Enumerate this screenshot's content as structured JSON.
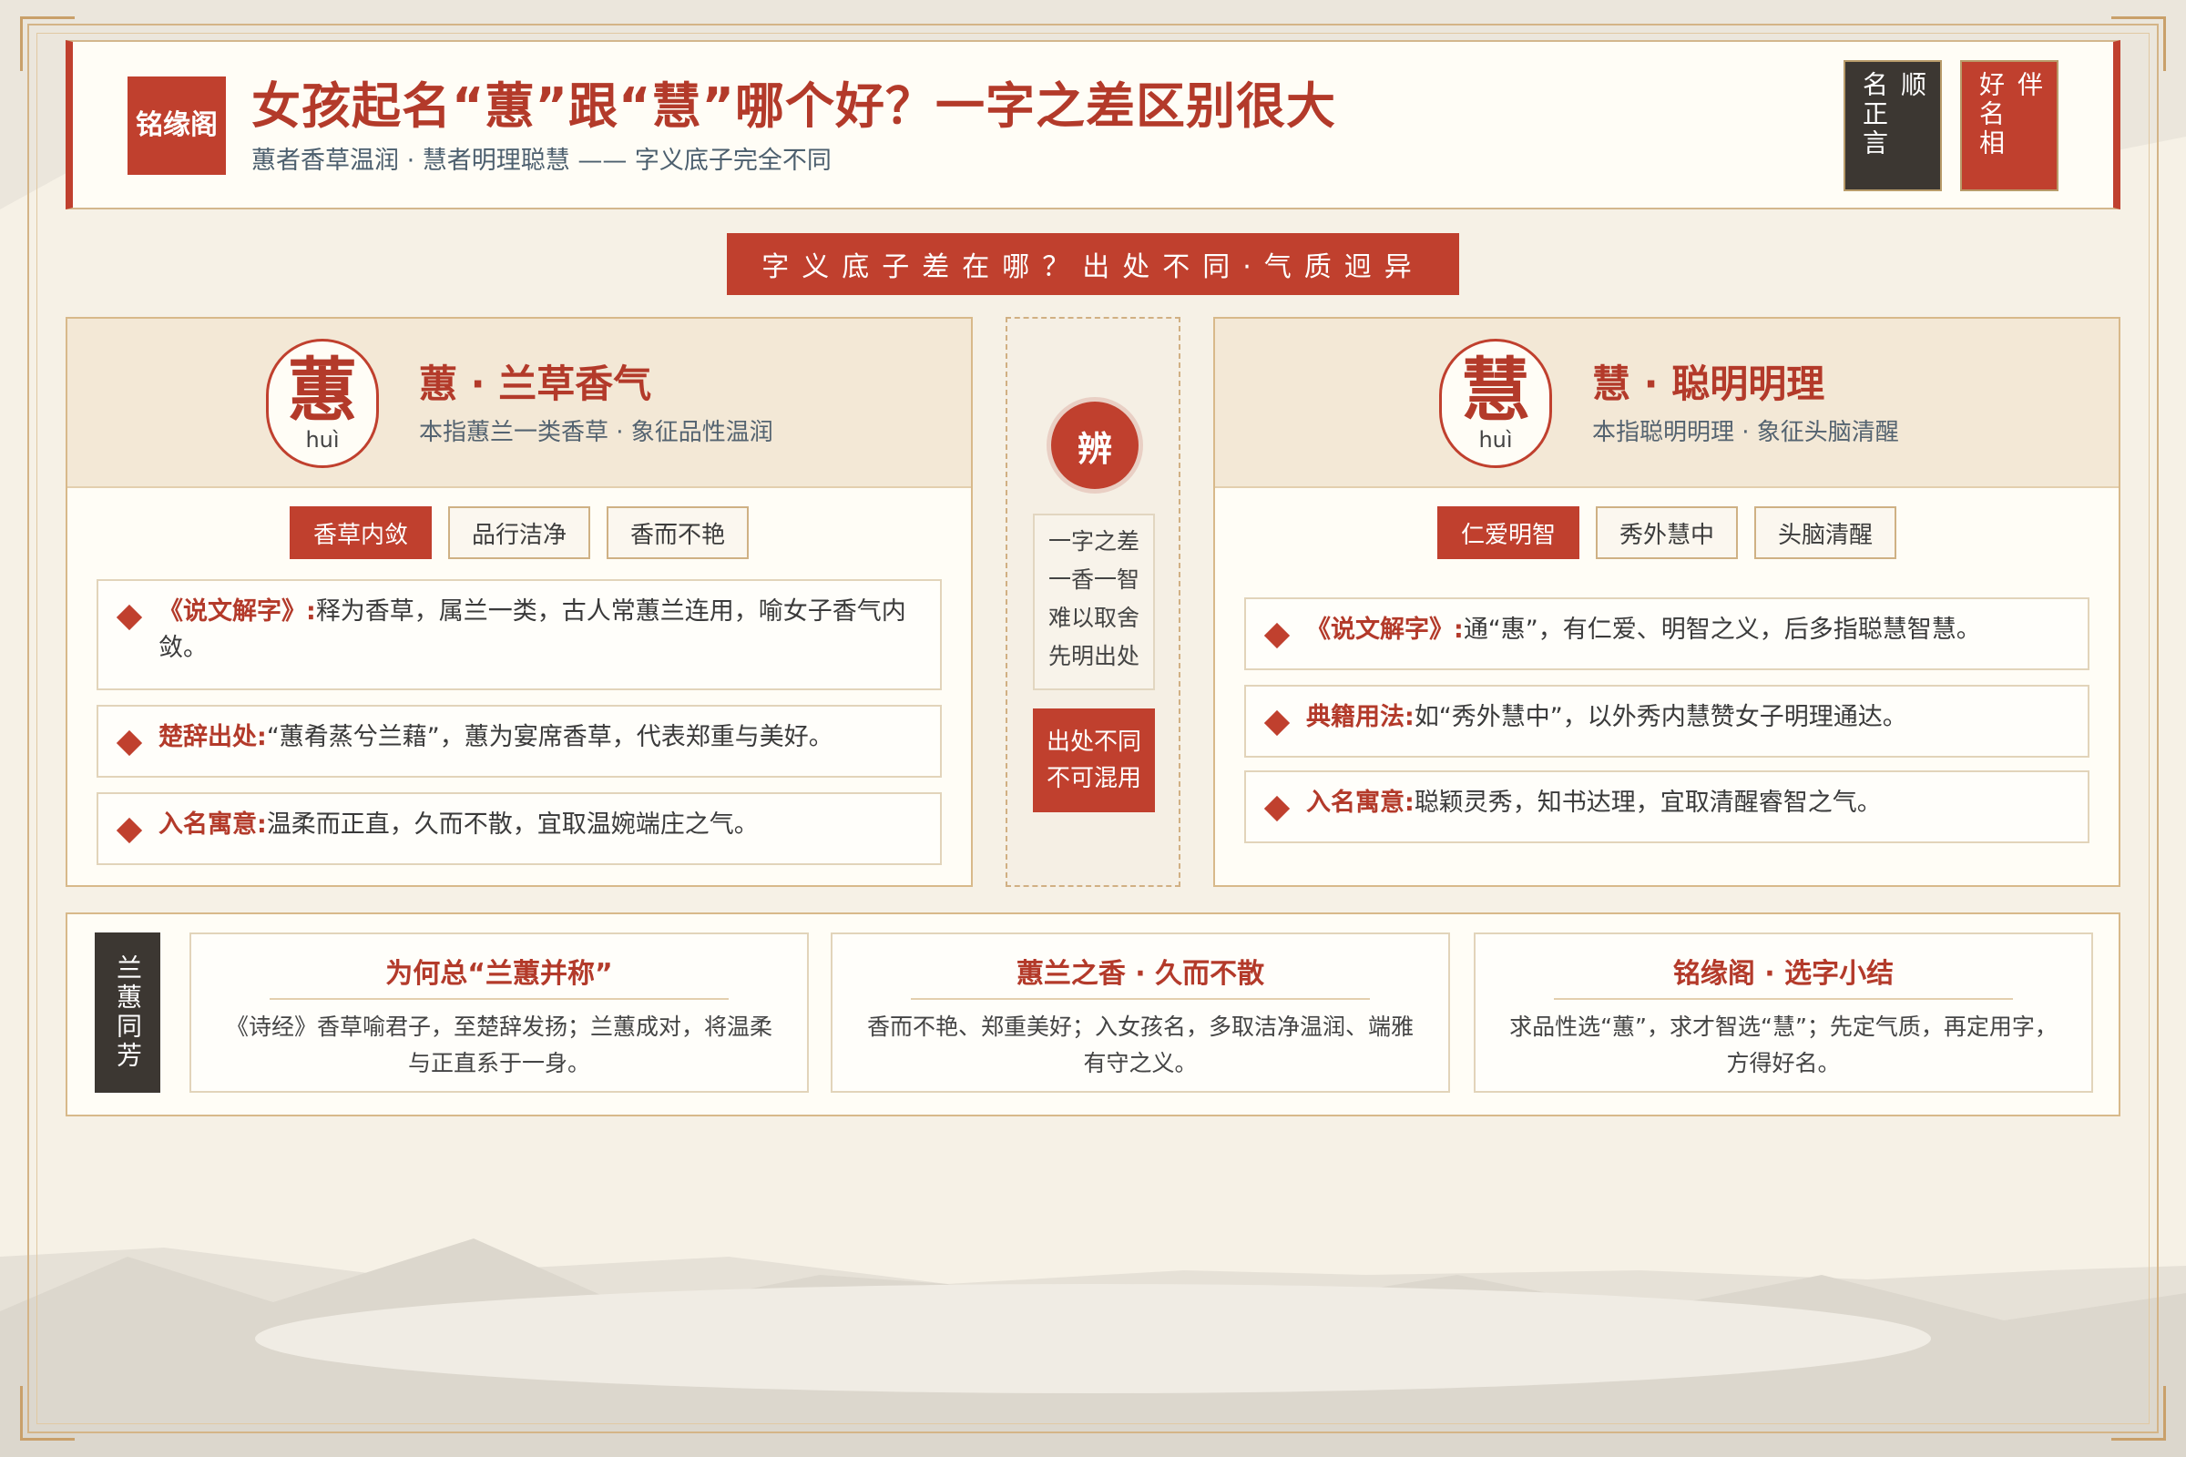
{
  "header": {
    "brand": "铭缘阁",
    "title": "女孩起名“蕙”跟“慧”哪个好？一字之差区别很大",
    "subtitle": "蕙者香草温润 · 慧者明理聪慧 —— 字义底子完全不同",
    "seal_dark": [
      "顺",
      "名正言"
    ],
    "seal_red": [
      "伴",
      "好名相"
    ]
  },
  "banner": "字义底子差在哪？出处不同·气质迥异",
  "left": {
    "char": "蕙",
    "pinyin": "huì",
    "title": "蕙 · 兰草香气",
    "desc": "本指蕙兰一类香草 · 象征品性温润",
    "tags": [
      "香草内敛",
      "品行洁净",
      "香而不艳"
    ],
    "items": [
      {
        "k": "《说文解字》:",
        "v": "释为香草，属兰一类，古人常蕙兰连用，喻女子香气内敛。"
      },
      {
        "k": "楚辞出处:",
        "v": "“蕙肴蒸兮兰藉”，蕙为宴席香草，代表郑重与美好。"
      },
      {
        "k": "入名寓意:",
        "v": "温柔而正直，久而不散，宜取温婉端庄之气。"
      }
    ]
  },
  "right": {
    "char": "慧",
    "pinyin": "huì",
    "title": "慧 · 聪明明理",
    "desc": "本指聪明明理 · 象征头脑清醒",
    "tags": [
      "仁爱明智",
      "秀外慧中",
      "头脑清醒"
    ],
    "items": [
      {
        "k": "《说文解字》:",
        "v": "通“惠”，有仁爱、明智之义，后多指聪慧智慧。"
      },
      {
        "k": "典籍用法:",
        "v": "如“秀外慧中”，以外秀内慧赞女子明理通达。"
      },
      {
        "k": "入名寓意:",
        "v": "聪颖灵秀，知书达理，宜取清醒睿智之气。"
      }
    ]
  },
  "center": {
    "badge": "辨",
    "lines": [
      "一字之差",
      "一香一智",
      "难以取舍",
      "先明出处"
    ],
    "note": [
      "出处不同",
      "不可混用"
    ]
  },
  "bottom": {
    "label": "兰蕙同芳",
    "cards": [
      {
        "title": "为何总“兰蕙并称”",
        "text": "《诗经》香草喻君子，至楚辞发扬；兰蕙成对，将温柔与正直系于一身。"
      },
      {
        "title": "蕙兰之香 · 久而不散",
        "text": "香而不艳、郑重美好；入女孩名，多取洁净温润、端雅有守之义。"
      },
      {
        "title": "铭缘阁 · 选字小结",
        "text": "求品性选“蕙”，求才智选“慧”；先定气质，再定用字，方得好名。"
      }
    ]
  },
  "colors": {
    "accent": "#c0402e",
    "dark": "#3c3732",
    "gold": "#d4b487",
    "background": "#f6f1e6"
  }
}
